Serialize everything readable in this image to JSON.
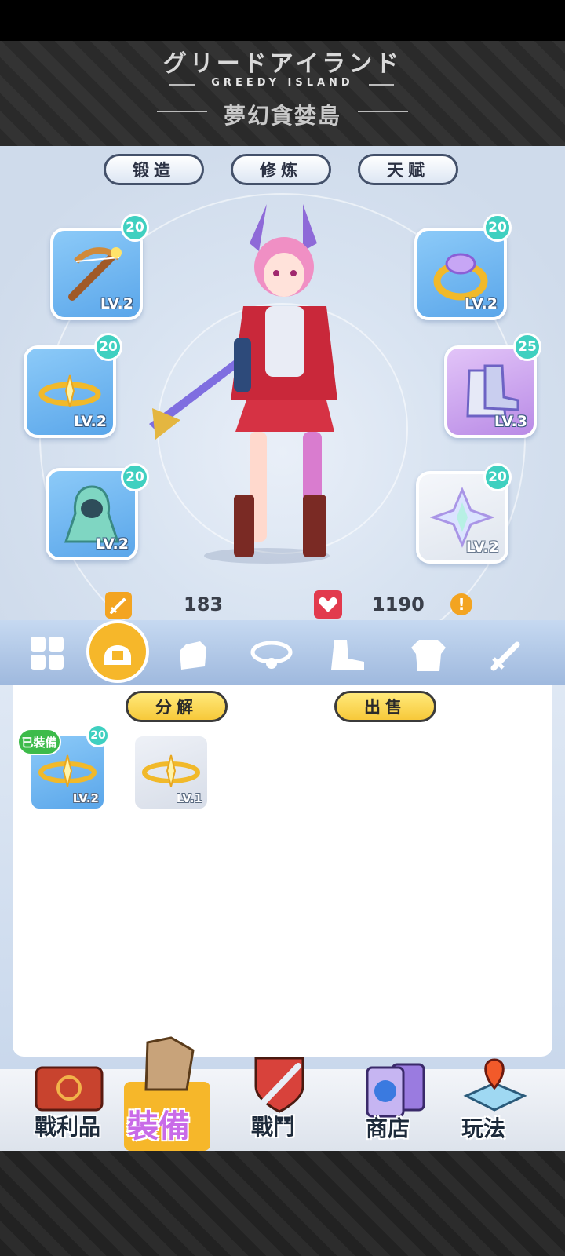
{
  "banner": {
    "title_jp": "グリードアイランド",
    "title_en": "GREEDY ISLAND",
    "title_cn": "夢幻貪婪島"
  },
  "top_tabs": [
    "锻造",
    "修炼",
    "天赋"
  ],
  "slots": [
    {
      "name": "crossbow",
      "level": "LV.2",
      "badge": "20",
      "rarity": "blue"
    },
    {
      "name": "halo",
      "level": "LV.2",
      "badge": "20",
      "rarity": "blue"
    },
    {
      "name": "cloak",
      "level": "LV.2",
      "badge": "20",
      "rarity": "blue"
    },
    {
      "name": "ring",
      "level": "LV.2",
      "badge": "20",
      "rarity": "blue"
    },
    {
      "name": "boots",
      "level": "LV.3",
      "badge": "25",
      "rarity": "purple"
    },
    {
      "name": "crystal",
      "level": "LV.2",
      "badge": "20",
      "rarity": "white"
    }
  ],
  "stats": {
    "attack": "183",
    "hp": "1190"
  },
  "categories": [
    "all-icon",
    "helmet-icon",
    "glove-icon",
    "necklace-icon",
    "boot-icon",
    "armor-icon",
    "sword-icon"
  ],
  "inventory": {
    "decompose_label": "分解",
    "sell_label": "出售",
    "equipped_tag": "已裝備",
    "items": [
      {
        "level": "LV.2",
        "badge": "20",
        "equipped": true
      },
      {
        "level": "LV.1",
        "badge": "",
        "equipped": false
      }
    ]
  },
  "nav": [
    {
      "label": "戰利品"
    },
    {
      "label": "裝備"
    },
    {
      "label": "戰鬥"
    },
    {
      "label": "商店"
    },
    {
      "label": "玩法"
    }
  ],
  "colors": {
    "accent": "#f6b72a",
    "badge": "#3fd0c0",
    "active_nav": "#c96be8"
  }
}
